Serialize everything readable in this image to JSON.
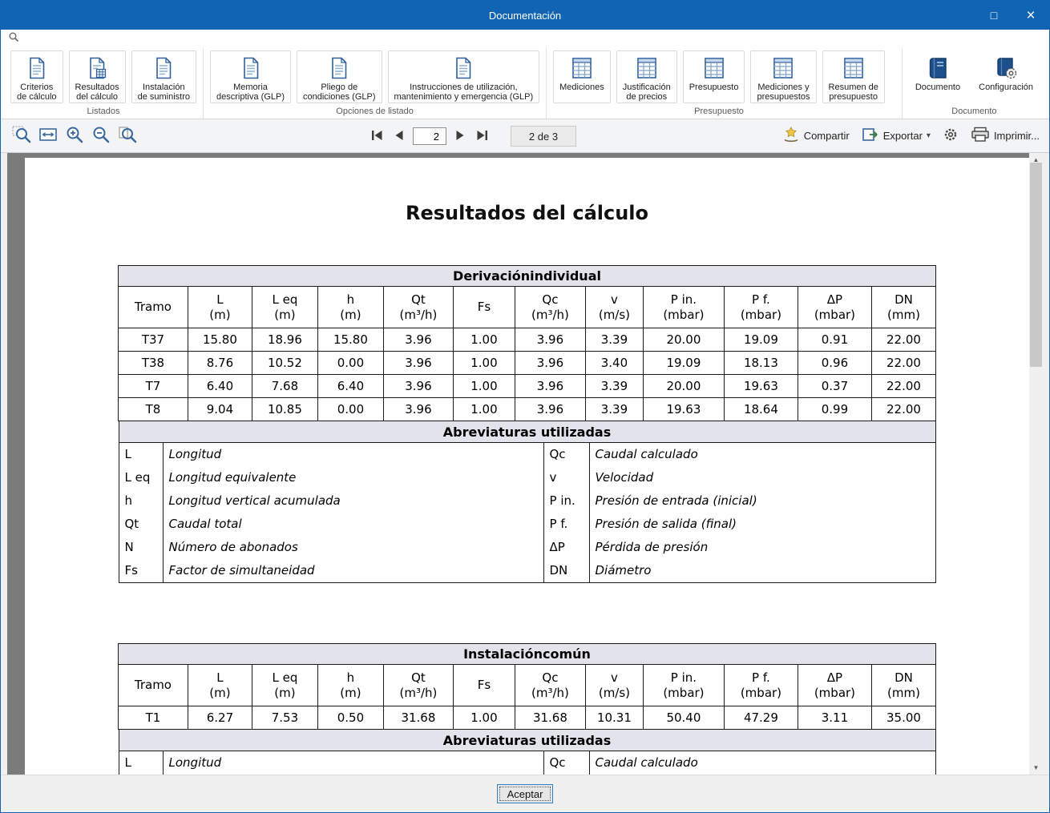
{
  "window": {
    "title": "Documentación",
    "maximize_glyph": "□",
    "close_glyph": "×"
  },
  "ribbon": {
    "groups": [
      {
        "label": "Listados",
        "items": [
          {
            "label": "Criterios\nde cálculo",
            "name": "criterios-de-calculo",
            "icon": "calc-criteria-doc-icon",
            "kind": "doc"
          },
          {
            "label": "Resultados\ndel cálculo",
            "name": "resultados-del-calculo",
            "icon": "calc-results-doc-icon",
            "kind": "calc"
          },
          {
            "label": "Instalación\nde suministro",
            "name": "instalacion-de-suministro",
            "icon": "supply-installation-doc-icon",
            "kind": "doc"
          }
        ]
      },
      {
        "label": "Opciones de listado",
        "items": [
          {
            "label": "Memoria\ndescriptiva (GLP)",
            "name": "memoria-descriptiva-glp",
            "icon": "memoria-doc-icon",
            "kind": "doc"
          },
          {
            "label": "Pliego de\ncondiciones (GLP)",
            "name": "pliego-de-condiciones-glp",
            "icon": "pliego-doc-icon",
            "kind": "doc"
          },
          {
            "label": "Instrucciones de utilización,\nmantenimiento y emergencia (GLP)",
            "name": "instrucciones-glp",
            "icon": "instrucciones-doc-icon",
            "kind": "doc"
          }
        ]
      },
      {
        "label": "Presupuesto",
        "items": [
          {
            "label": "Mediciones",
            "name": "mediciones",
            "icon": "mediciones-sheet-icon",
            "kind": "sheet"
          },
          {
            "label": "Justificación\nde precios",
            "name": "justificacion-de-precios",
            "icon": "justificacion-sheet-icon",
            "kind": "sheet"
          },
          {
            "label": "Presupuesto",
            "name": "presupuesto",
            "icon": "presupuesto-sheet-icon",
            "kind": "sheet"
          },
          {
            "label": "Mediciones y\npresupuestos",
            "name": "mediciones-y-presupuestos",
            "icon": "mediciones-presupuestos-sheet-icon",
            "kind": "sheet"
          },
          {
            "label": "Resumen de\npresupuesto",
            "name": "resumen-de-presupuesto",
            "icon": "resumen-sheet-icon",
            "kind": "sheet"
          }
        ]
      },
      {
        "label": "Documento",
        "items": [
          {
            "label": "Documento",
            "name": "documento",
            "icon": "document-book-icon",
            "kind": "book"
          },
          {
            "label": "Configuración",
            "name": "configuracion",
            "icon": "configuration-book-gear-icon",
            "kind": "bookgear"
          }
        ]
      }
    ]
  },
  "toolbar": {
    "nav": {
      "page_value": "2",
      "pages_label": "2 de 3"
    },
    "share_label": "Compartir",
    "export_label": "Exportar",
    "print_label": "Imprimir..."
  },
  "document": {
    "title": "Resultados del cálculo",
    "sections": [
      {
        "table_title": "Derivaciónindividual",
        "columns": [
          "Tramo",
          "L\n(m)",
          "L eq\n(m)",
          "h\n(m)",
          "Qt\n(m³/h)",
          "Fs",
          "Qc\n(m³/h)",
          "v\n(m/s)",
          "P in.\n(mbar)",
          "P f.\n(mbar)",
          "ΔP\n(mbar)",
          "DN\n(mm)"
        ],
        "rows": [
          [
            "T37",
            "15.80",
            "18.96",
            "15.80",
            "3.96",
            "1.00",
            "3.96",
            "3.39",
            "20.00",
            "19.09",
            "0.91",
            "22.00"
          ],
          [
            "T38",
            "8.76",
            "10.52",
            "0.00",
            "3.96",
            "1.00",
            "3.96",
            "3.40",
            "19.09",
            "18.13",
            "0.96",
            "22.00"
          ],
          [
            "T7",
            "6.40",
            "7.68",
            "6.40",
            "3.96",
            "1.00",
            "3.96",
            "3.39",
            "20.00",
            "19.63",
            "0.37",
            "22.00"
          ],
          [
            "T8",
            "9.04",
            "10.85",
            "0.00",
            "3.96",
            "1.00",
            "3.96",
            "3.39",
            "19.63",
            "18.64",
            "0.99",
            "22.00"
          ]
        ],
        "abbrev_title": "Abreviaturas utilizadas",
        "abbrev_left": [
          [
            "L",
            "Longitud"
          ],
          [
            "L eq",
            "Longitud equivalente"
          ],
          [
            "h",
            "Longitud vertical acumulada"
          ],
          [
            "Qt",
            "Caudal total"
          ],
          [
            "N",
            "Número de abonados"
          ],
          [
            "Fs",
            "Factor de simultaneidad"
          ]
        ],
        "abbrev_right": [
          [
            "Qc",
            "Caudal calculado"
          ],
          [
            "v",
            "Velocidad"
          ],
          [
            "P in.",
            "Presión de entrada (inicial)"
          ],
          [
            "P f.",
            "Presión de salida (final)"
          ],
          [
            "ΔP",
            "Pérdida de presión"
          ],
          [
            "DN",
            "Diámetro"
          ]
        ]
      },
      {
        "table_title": "Instalacióncomún",
        "columns": [
          "Tramo",
          "L\n(m)",
          "L eq\n(m)",
          "h\n(m)",
          "Qt\n(m³/h)",
          "Fs",
          "Qc\n(m³/h)",
          "v\n(m/s)",
          "P in.\n(mbar)",
          "P f.\n(mbar)",
          "ΔP\n(mbar)",
          "DN\n(mm)"
        ],
        "rows": [
          [
            "T1",
            "6.27",
            "7.53",
            "0.50",
            "31.68",
            "1.00",
            "31.68",
            "10.31",
            "50.40",
            "47.29",
            "3.11",
            "35.00"
          ]
        ],
        "abbrev_title": "Abreviaturas utilizadas",
        "abbrev_left": [
          [
            "L",
            "Longitud"
          ]
        ],
        "abbrev_right": [
          [
            "Qc",
            "Caudal calculado"
          ]
        ]
      }
    ]
  },
  "footer": {
    "accept_label": "Aceptar"
  }
}
